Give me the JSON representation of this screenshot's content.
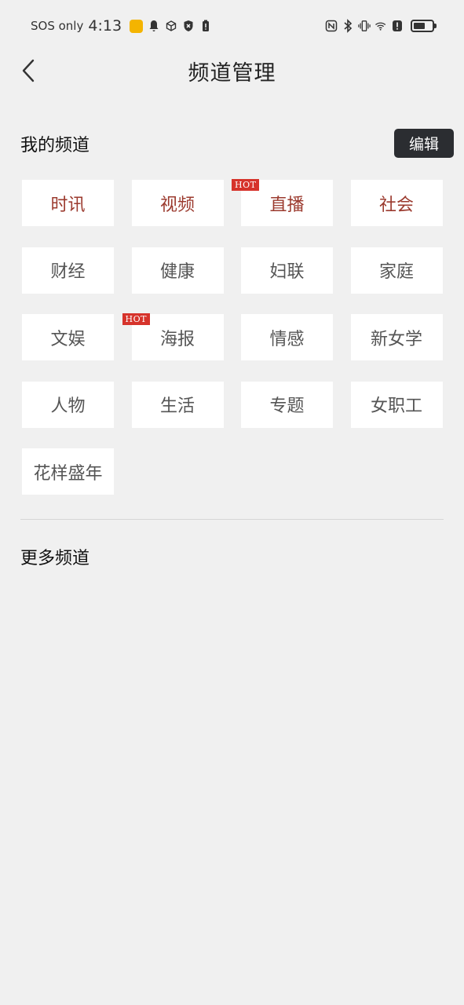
{
  "status": {
    "carrier": "SOS only",
    "time": "4:13"
  },
  "header": {
    "title": "频道管理"
  },
  "my_channels": {
    "title": "我的频道",
    "edit_label": "编辑",
    "hot_label": "HOT",
    "items": [
      {
        "label": "时讯",
        "fixed": true,
        "hot": false
      },
      {
        "label": "视频",
        "fixed": true,
        "hot": false
      },
      {
        "label": "直播",
        "fixed": true,
        "hot": true
      },
      {
        "label": "社会",
        "fixed": true,
        "hot": false
      },
      {
        "label": "财经",
        "fixed": false,
        "hot": false
      },
      {
        "label": "健康",
        "fixed": false,
        "hot": false
      },
      {
        "label": "妇联",
        "fixed": false,
        "hot": false
      },
      {
        "label": "家庭",
        "fixed": false,
        "hot": false
      },
      {
        "label": "文娱",
        "fixed": false,
        "hot": false
      },
      {
        "label": "海报",
        "fixed": false,
        "hot": true
      },
      {
        "label": "情感",
        "fixed": false,
        "hot": false
      },
      {
        "label": "新女学",
        "fixed": false,
        "hot": false
      },
      {
        "label": "人物",
        "fixed": false,
        "hot": false
      },
      {
        "label": "生活",
        "fixed": false,
        "hot": false
      },
      {
        "label": "专题",
        "fixed": false,
        "hot": false
      },
      {
        "label": "女职工",
        "fixed": false,
        "hot": false
      },
      {
        "label": "花样盛年",
        "fixed": false,
        "hot": false
      }
    ]
  },
  "more_channels": {
    "title": "更多频道"
  },
  "colors": {
    "background": "#f0f0f0",
    "fixed_text": "#9b3a2e",
    "hot_badge": "#d6332b",
    "edit_button": "#2b2d31"
  }
}
